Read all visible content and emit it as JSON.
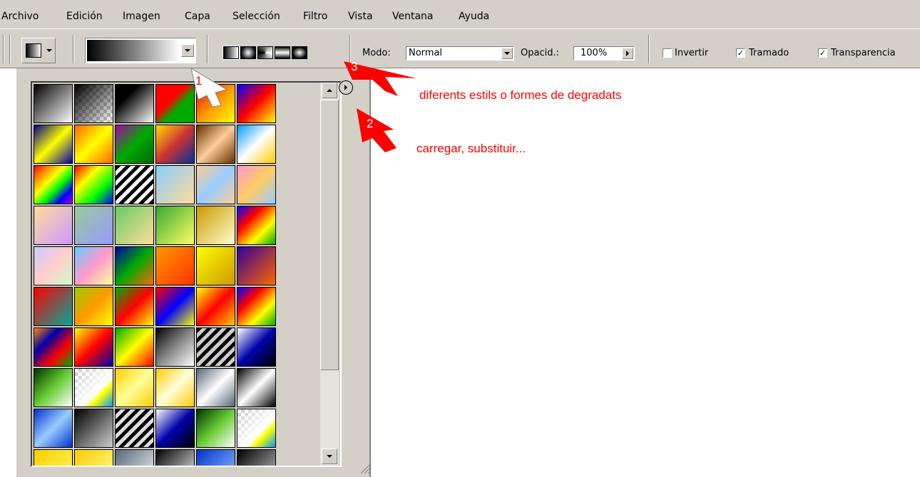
{
  "menu": [
    "Archivo",
    "Edición",
    "Imagen",
    "Capa",
    "Selección",
    "Filtro",
    "Vista",
    "Ventana",
    "Ayuda"
  ],
  "options": {
    "mode_label": "Modo:",
    "mode_value": "Normal",
    "opacity_label": "Opacid.:",
    "opacity_value": "100%",
    "invert_label": "Invertir",
    "invert_checked": false,
    "dither_label": "Tramado",
    "dither_checked": true,
    "transparency_label": "Transparencia",
    "transparency_checked": true
  },
  "gradient_types": [
    "linear-gradient-icon",
    "radial-gradient-icon",
    "angle-gradient-icon",
    "reflected-gradient-icon",
    "diamond-gradient-icon"
  ],
  "annotations": {
    "n1": "1",
    "n2": "2",
    "n3": "3",
    "t3": "diferents estils o formes de degradats",
    "t2": "carregar, substituir..."
  },
  "colors": {
    "chrome": "#d4d0c8",
    "annotation": "#ff0000"
  },
  "swatch_count": 60
}
